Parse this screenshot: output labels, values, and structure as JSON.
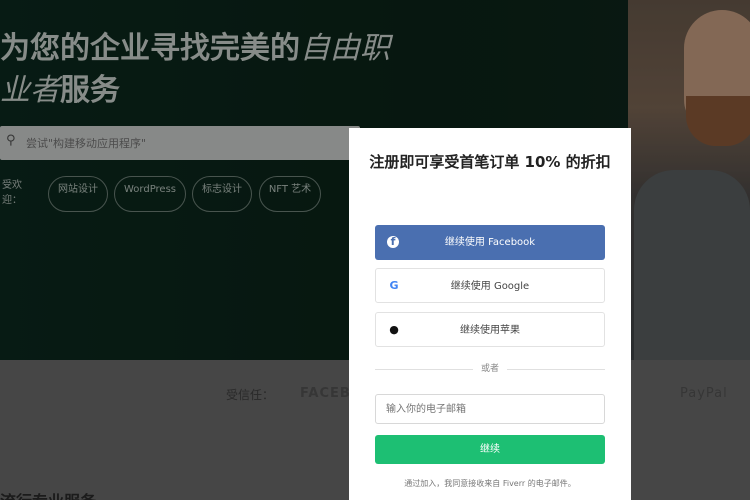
{
  "hero": {
    "title_line1": "为您的企业寻找完美的",
    "title_line1_italic": "自由职",
    "title_line2_italic": "业者",
    "title_line2": "服务",
    "search_placeholder": "尝试\"构建移动应用程序\"",
    "popular_label": "受欢迎：",
    "tags": [
      "网站设计",
      "WordPress",
      "标志设计",
      "NFT 艺术"
    ]
  },
  "trusted": {
    "label": "受信任：",
    "logos": [
      "FACEBOOK",
      "PayPal"
    ]
  },
  "bottom_heading": "流行专业服务",
  "modal": {
    "title": "注册即可享受首笔订单 10% 的折扣",
    "facebook_label": "继续使用 Facebook",
    "google_label": "继续使用 Google",
    "apple_label": "继续使用苹果",
    "divider_text": "或者",
    "email_placeholder": "输入你的电子邮箱",
    "continue_label": "继续",
    "terms_text": "通过加入，我同意接收来自 Fiverr 的电子邮件。"
  },
  "colors": {
    "facebook": "#4a6fb0",
    "continue": "#1dbf73",
    "hero_bg": "#0c2a1f"
  },
  "icons": [
    "search-icon",
    "facebook-icon",
    "google-icon",
    "apple-icon"
  ]
}
